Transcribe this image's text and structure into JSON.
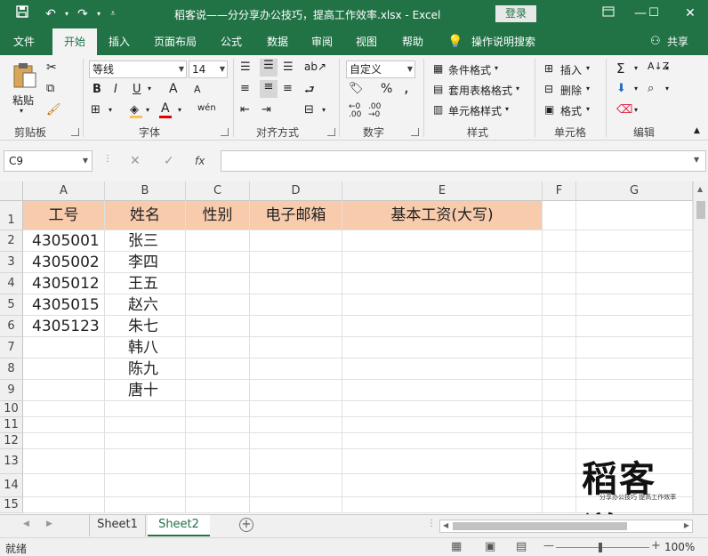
{
  "window": {
    "title": "稻客说——分分享办公技巧，提高工作效率.xlsx  -  Excel",
    "login_label": "登录",
    "minimize": "—",
    "restore": "☐",
    "close": "✕"
  },
  "quick_access": {
    "save_icon": "save-icon",
    "undo_icon": "undo-icon",
    "redo_icon": "redo-icon",
    "customize_icon": "customize-icon"
  },
  "tabs": [
    "文件",
    "开始",
    "插入",
    "页面布局",
    "公式",
    "数据",
    "审阅",
    "视图",
    "帮助"
  ],
  "tell_me": "操作说明搜索",
  "share": "共享",
  "ribbon": {
    "clipboard": {
      "label": "剪贴板",
      "paste": "粘贴"
    },
    "font": {
      "label": "字体",
      "name": "等线",
      "size": "14",
      "bold": "B",
      "italic": "I",
      "underline": "U",
      "grow": "A",
      "shrink": "A",
      "font_color": "A",
      "phonetic": "wén"
    },
    "alignment": {
      "label": "对齐方式"
    },
    "number": {
      "label": "数字",
      "format": "自定义",
      "percent": "%",
      "comma": ","
    },
    "styles": {
      "label": "样式",
      "conditional": "条件格式",
      "table": "套用表格格式",
      "cell_styles": "单元格样式"
    },
    "cells": {
      "label": "单元格",
      "insert": "插入",
      "delete": "删除",
      "format": "格式"
    },
    "editing": {
      "label": "编辑"
    }
  },
  "formula_bar": {
    "name_box": "C9",
    "fx": "fx",
    "cancel": "✕",
    "enter": "✓",
    "content": ""
  },
  "columns": [
    "A",
    "B",
    "C",
    "D",
    "E",
    "F",
    "G"
  ],
  "rows": [
    "1",
    "2",
    "3",
    "4",
    "5",
    "6",
    "7",
    "8",
    "9",
    "10",
    "11",
    "12",
    "13",
    "14",
    "15"
  ],
  "header_row": [
    "工号",
    "姓名",
    "性别",
    "电子邮箱",
    "基本工资(大写)"
  ],
  "ids": [
    "4305001",
    "4305002",
    "4305012",
    "4305015",
    "4305123"
  ],
  "names": [
    "张三",
    "李四",
    "王五",
    "赵六",
    "朱七",
    "韩八",
    "陈九",
    "唐十"
  ],
  "header_fill": "#f8cbad",
  "watermark": {
    "big": "稻客说",
    "small": "分享办公技巧  提高工作效率"
  },
  "sheets": [
    "Sheet1",
    "Sheet2"
  ],
  "active_sheet": "Sheet2",
  "status": {
    "text": "就绪",
    "zoom": "100%",
    "zoom_out": "—",
    "zoom_in": "+"
  },
  "accent_color": "#217346"
}
